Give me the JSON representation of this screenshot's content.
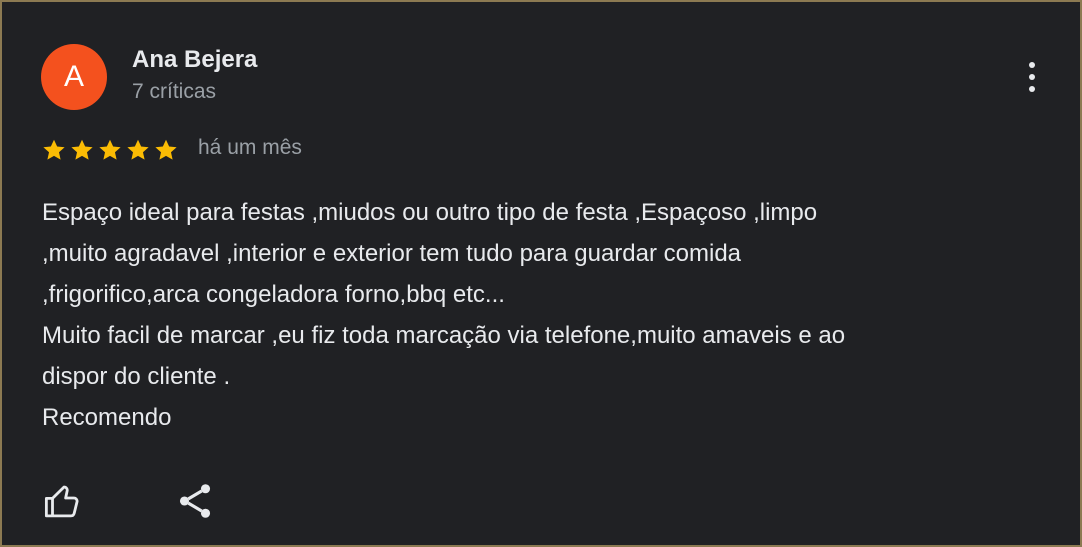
{
  "review": {
    "avatar_letter": "A",
    "avatar_color": "#f4511e",
    "reviewer_name": "Ana Bejera",
    "review_count": "7 críticas",
    "rating": 5,
    "rating_max": 5,
    "star_color": "#fbbc04",
    "date": "há um mês",
    "text_lines": [
      "Espaço ideal para festas ,miudos ou outro tipo de festa ,Espaçoso ,limpo",
      ",muito agradavel ,interior e exterior tem tudo para guardar comida",
      ",frigorifico,arca congeladora forno,bbq etc...",
      "Muito facil de marcar ,eu fiz toda marcação via telefone,muito amaveis e ao",
      "dispor do cliente .",
      "Recomendo"
    ]
  },
  "icons": {
    "more": "more-vert-icon",
    "like": "thumbs-up-icon",
    "share": "share-icon"
  }
}
